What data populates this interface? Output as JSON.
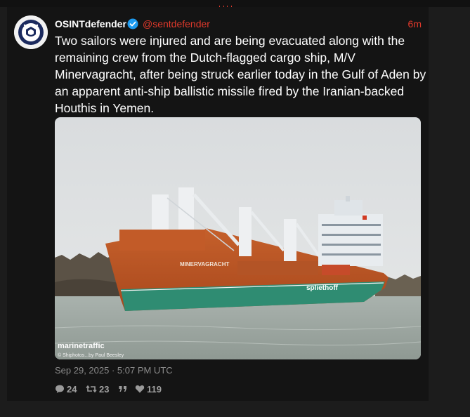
{
  "tweet": {
    "display_name": "OSINTdefender",
    "handle": "@sentdefender",
    "relative_time": "6m",
    "text": "Two sailors were injured and are being evacuated along with the remaining crew from the Dutch-flagged cargo ship, M/V Minervagracht, after being struck earlier today in the Gulf of Aden by an apparent anti-ship ballistic missile fired by the Iranian-backed Houthis in Yemen.",
    "timestamp": "Sep 29, 2025 · 5:07 PM UTC",
    "replies": "24",
    "retweets": "23",
    "likes": "119",
    "accent_color": "#e0392b",
    "verified_color": "#1d9bf0"
  },
  "media": {
    "ship_name": "MINERVAGRACHT",
    "hull_brand": "spliethoff",
    "watermark": "marinetraffic",
    "credit": "© Shiphotos...by Paul Beesley"
  },
  "icons": {
    "reply": "reply-icon",
    "retweet": "retweet-icon",
    "quote": "quote-icon",
    "like": "heart-icon",
    "verified": "verified-badge-icon"
  }
}
